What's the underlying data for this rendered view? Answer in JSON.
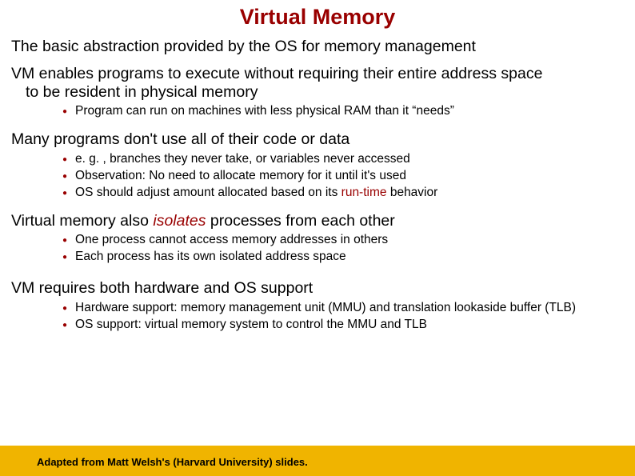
{
  "title": "Virtual Memory",
  "p1": "The basic abstraction provided by the OS for memory management",
  "p2_line1": "VM enables programs to execute without requiring their entire address space",
  "p2_line2": "to be resident in physical memory",
  "l2": {
    "a": "Program can run on machines with less physical RAM than it “needs”"
  },
  "p3": "Many programs don't use all of their code or data",
  "l3": {
    "a": "e. g. , branches they never take, or variables never accessed",
    "b": "Observation: No need to allocate memory for it until it's used",
    "c_pre": "OS should adjust amount allocated based on its ",
    "c_accent": "run-time",
    "c_post": " behavior"
  },
  "p4_pre": "Virtual memory also ",
  "p4_accent": "isolates",
  "p4_post": " processes from each other",
  "l4": {
    "a": "One process cannot access memory addresses in others",
    "b": "Each process has its own isolated address space"
  },
  "p5": "VM requires both hardware and OS support",
  "l5": {
    "a": "Hardware support: memory management unit (MMU) and translation lookaside buffer (TLB)",
    "b": "OS support: virtual memory system to control the MMU and TLB"
  },
  "footer": "Adapted from Matt Welsh's (Harvard University) slides."
}
